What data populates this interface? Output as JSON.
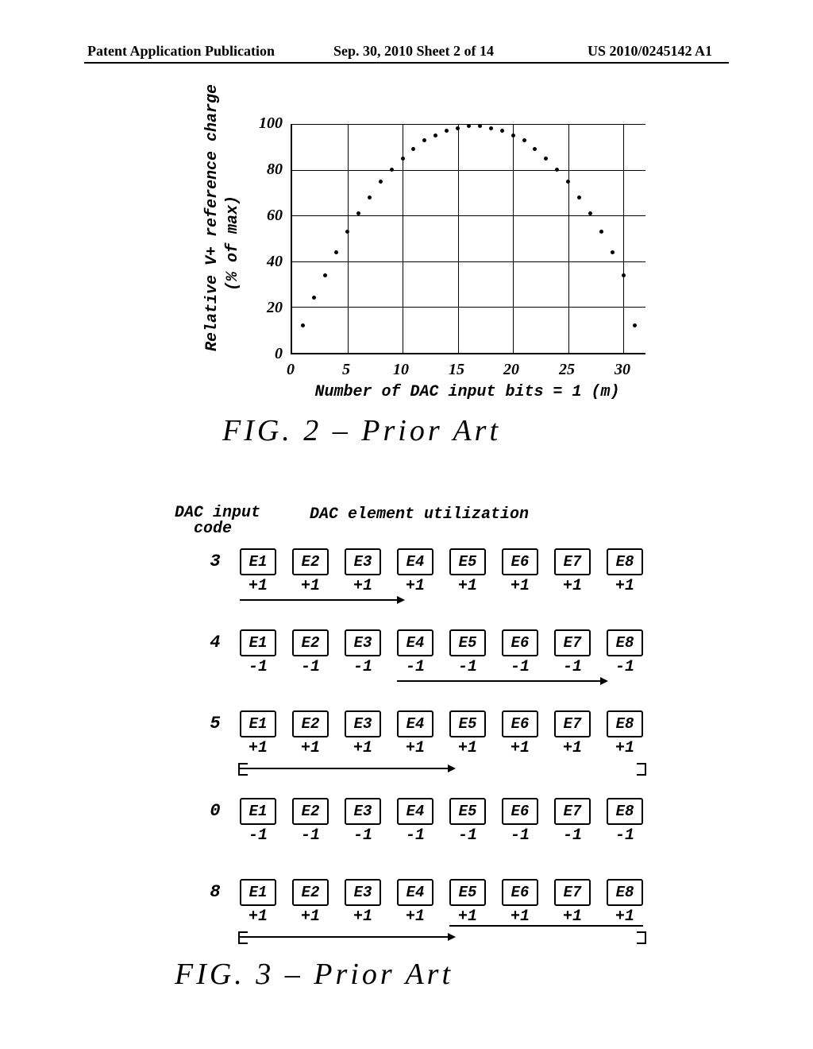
{
  "header": {
    "left": "Patent Application Publication",
    "center": "Sep. 30, 2010  Sheet 2 of 14",
    "right": "US 2010/0245142 A1"
  },
  "fig2": {
    "caption": "FIG. 2 – Prior Art",
    "ylabel1": "Relative V+ reference charge",
    "ylabel2": "(% of max)",
    "xlabel": "Number of DAC input bits = 1 (m)",
    "yticks": [
      "0",
      "20",
      "40",
      "60",
      "80",
      "100"
    ],
    "xticks": [
      "0",
      "5",
      "10",
      "15",
      "20",
      "25",
      "30"
    ]
  },
  "chart_data": {
    "type": "scatter",
    "title": "Relative V+ reference charge vs number of DAC input bits = 1",
    "xlabel": "Number of DAC input bits = 1 (m)",
    "ylabel": "Relative V+ reference charge (% of max)",
    "xlim": [
      0,
      32
    ],
    "ylim": [
      0,
      100
    ],
    "x": [
      1,
      2,
      3,
      4,
      5,
      6,
      7,
      8,
      9,
      10,
      11,
      12,
      13,
      14,
      15,
      16,
      17,
      18,
      19,
      20,
      21,
      22,
      23,
      24,
      25,
      26,
      27,
      28,
      29,
      30,
      31
    ],
    "y": [
      12,
      24,
      34,
      44,
      53,
      61,
      68,
      75,
      80,
      85,
      89,
      93,
      95,
      97,
      98,
      99,
      99,
      98,
      97,
      95,
      93,
      89,
      85,
      80,
      75,
      68,
      61,
      53,
      44,
      34,
      12
    ]
  },
  "fig3": {
    "caption": "FIG. 3 – Prior Art",
    "input_label": "DAC input",
    "input_label2": "code",
    "util_label": "DAC element utilization",
    "elements": [
      "E1",
      "E2",
      "E3",
      "E4",
      "E5",
      "E6",
      "E7",
      "E8"
    ],
    "rows": [
      {
        "code": "3",
        "signs": [
          "+1",
          "+1",
          "+1",
          "+1",
          "+1",
          "+1",
          "+1",
          "+1"
        ]
      },
      {
        "code": "4",
        "signs": [
          "-1",
          "-1",
          "-1",
          "-1",
          "-1",
          "-1",
          "-1",
          "-1"
        ]
      },
      {
        "code": "5",
        "signs": [
          "+1",
          "+1",
          "+1",
          "+1",
          "+1",
          "+1",
          "+1",
          "+1"
        ]
      },
      {
        "code": "0",
        "signs": [
          "-1",
          "-1",
          "-1",
          "-1",
          "-1",
          "-1",
          "-1",
          "-1"
        ]
      },
      {
        "code": "8",
        "signs": [
          "+1",
          "+1",
          "+1",
          "+1",
          "+1",
          "+1",
          "+1",
          "+1"
        ]
      }
    ]
  }
}
